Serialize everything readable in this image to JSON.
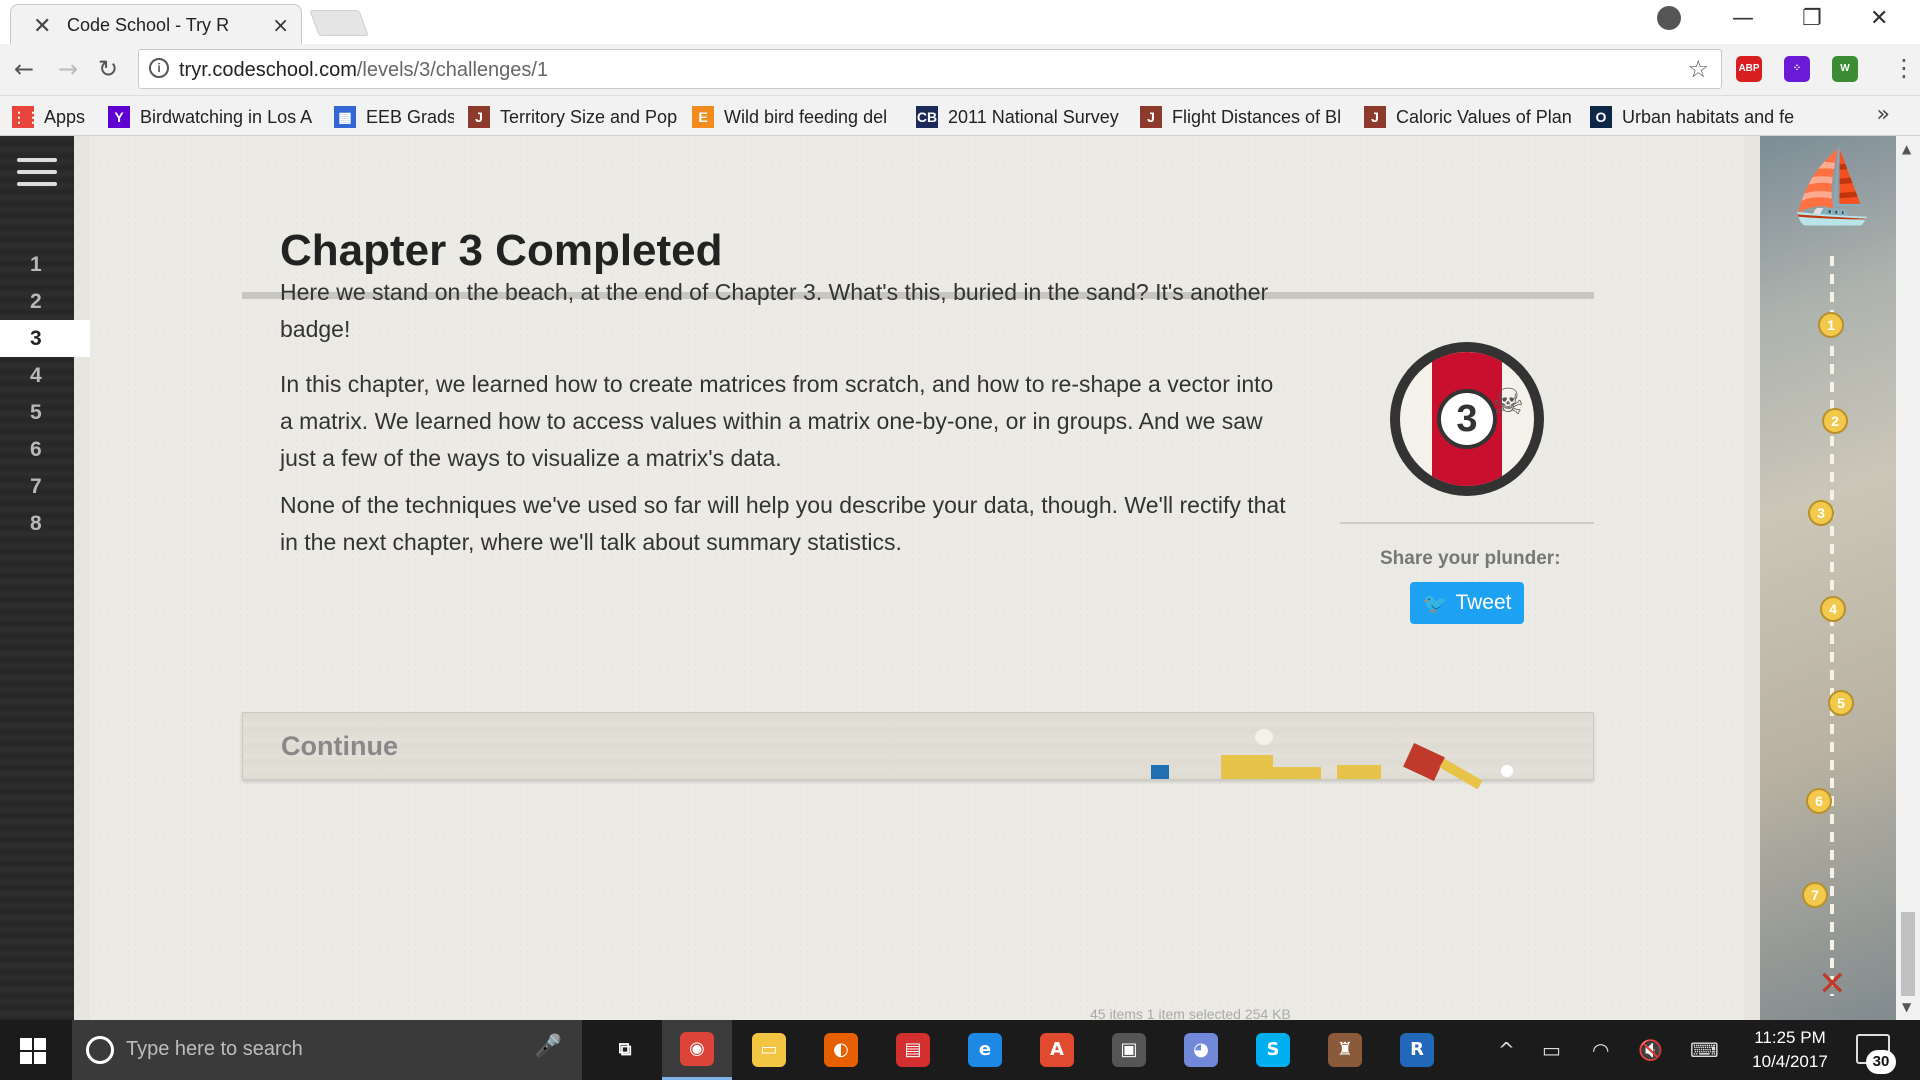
{
  "browser": {
    "tab_title": "Code School - Try R",
    "tab_close": "×",
    "url_host": "tryr.codeschool.com",
    "url_path": "/levels/3/challenges/1",
    "info_glyph": "i",
    "star_glyph": "☆",
    "extensions": [
      {
        "name": "adblock-plus-icon",
        "text": "ABP",
        "color": "#d81e1e"
      },
      {
        "name": "dots-extension-icon",
        "text": "⁘",
        "color": "#6a1bd6"
      },
      {
        "name": "shield-extension-icon",
        "text": "W",
        "color": "#3c8c35"
      }
    ]
  },
  "bookmarks": {
    "items": [
      {
        "label": "Apps",
        "icon": "apps-grid-icon",
        "icon_text": "⋮⋮",
        "icon_color": "#e8453c"
      },
      {
        "label": "Birdwatching in Los A",
        "icon": "yahoo-icon",
        "icon_text": "Y",
        "icon_color": "#5f01d1"
      },
      {
        "label": "EEB Grads",
        "icon": "calendar-icon",
        "icon_text": "▦",
        "icon_color": "#3367d6"
      },
      {
        "label": "Territory Size and Pop",
        "icon": "jstor-icon",
        "icon_text": "J",
        "icon_color": "#8b3a2b"
      },
      {
        "label": "Wild bird feeding del",
        "icon": "elsevier-icon",
        "icon_text": "E",
        "icon_color": "#f28c1e"
      },
      {
        "label": "2011 National Survey",
        "icon": "cb-icon",
        "icon_text": "CB",
        "icon_color": "#1c2a5a"
      },
      {
        "label": "Flight Distances of Bl",
        "icon": "jstor-icon",
        "icon_text": "J",
        "icon_color": "#8b3a2b"
      },
      {
        "label": "Caloric Values of Plan",
        "icon": "jstor-icon",
        "icon_text": "J",
        "icon_color": "#8b3a2b"
      },
      {
        "label": "Urban habitats and fe",
        "icon": "oxford-icon",
        "icon_text": "O",
        "icon_color": "#0f2747"
      }
    ],
    "more": "»"
  },
  "sidebar": {
    "chapters": [
      "1",
      "2",
      "3",
      "4",
      "5",
      "6",
      "7",
      "8"
    ],
    "active": "3"
  },
  "main": {
    "title": "Chapter 3 Completed",
    "paragraphs": [
      "Here we stand on the beach, at the end of Chapter 3. What's this, buried in the sand? It's another badge!",
      "In this chapter, we learned how to create matrices from scratch, and how to re-shape a vector into a matrix. We learned how to access values within a matrix one-by-one, or in groups. And we saw just a few of the ways to visualize a matrix's data.",
      "None of the techniques we've used so far will help you describe your data, though. We'll rectify that in the next chapter, where we'll talk about summary statistics."
    ],
    "badge_number": "3",
    "share_label": "Share your plunder:",
    "tweet_label": "Tweet",
    "continue_label": "Continue",
    "faint_status": "45 items    1 item selected  254 KB"
  },
  "map": {
    "nodes": [
      "1",
      "2",
      "3",
      "4",
      "5",
      "6",
      "7"
    ],
    "end_marker": "✕"
  },
  "taskbar": {
    "search_placeholder": "Type here to search",
    "time": "11:25 PM",
    "date": "10/4/2017",
    "notification_count": "30",
    "apps": [
      {
        "name": "task-view-icon",
        "text": "⧉",
        "color": "transparent"
      },
      {
        "name": "chrome-icon",
        "text": "◉",
        "color": "#db4437"
      },
      {
        "name": "file-explorer-icon",
        "text": "▭",
        "color": "#f4c542"
      },
      {
        "name": "firefox-icon",
        "text": "◐",
        "color": "#e66000"
      },
      {
        "name": "reader-icon",
        "text": "▤",
        "color": "#d32f2f"
      },
      {
        "name": "edge-icon",
        "text": "e",
        "color": "#1e88e5"
      },
      {
        "name": "acrobat-icon",
        "text": "A",
        "color": "#e04b2f"
      },
      {
        "name": "store-icon",
        "text": "▣",
        "color": "#555555"
      },
      {
        "name": "discord-icon",
        "text": "◕",
        "color": "#7289da"
      },
      {
        "name": "skype-icon",
        "text": "S",
        "color": "#00aff0"
      },
      {
        "name": "game-icon",
        "text": "♜",
        "color": "#8a5a3a"
      },
      {
        "name": "r-icon",
        "text": "R",
        "color": "#2268b8"
      }
    ],
    "tray": [
      "^",
      "▭",
      "◠",
      "🔇",
      "⌨"
    ]
  }
}
